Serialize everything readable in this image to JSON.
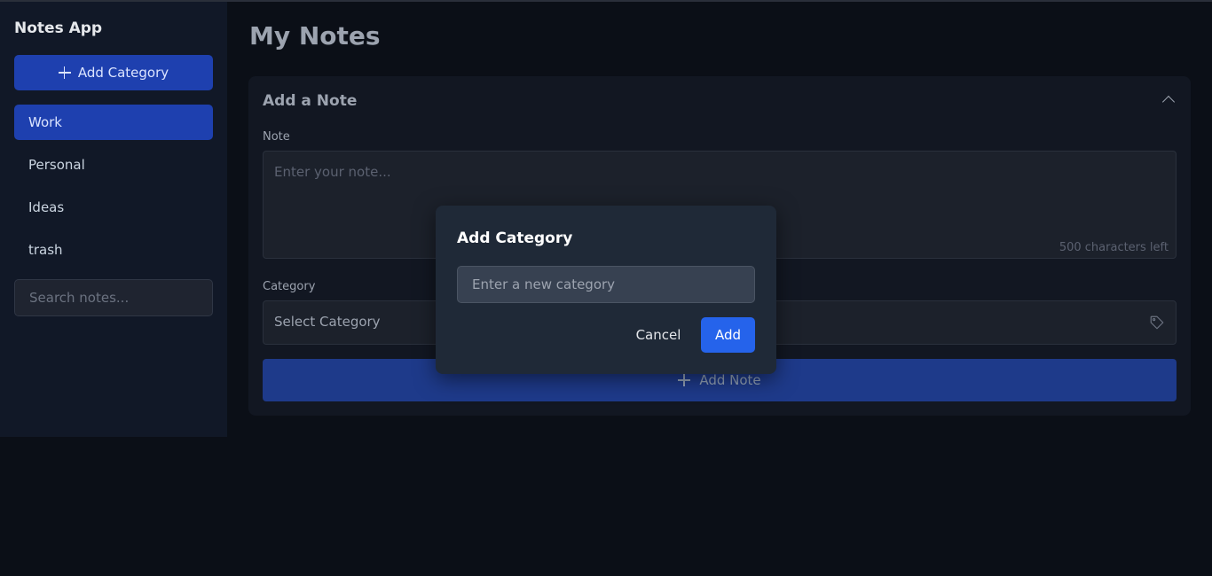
{
  "sidebar": {
    "app_title": "Notes App",
    "add_category_label": "Add Category",
    "categories": [
      {
        "label": "Work",
        "active": true
      },
      {
        "label": "Personal",
        "active": false
      },
      {
        "label": "Ideas",
        "active": false
      },
      {
        "label": "trash",
        "active": false
      }
    ],
    "search_placeholder": "Search notes..."
  },
  "main": {
    "title": "My Notes",
    "card": {
      "header": "Add a Note",
      "note_label": "Note",
      "note_placeholder": "Enter your note...",
      "chars_left": "500 characters left",
      "category_label": "Category",
      "category_select": "Select Category",
      "add_note_label": "Add Note"
    }
  },
  "modal": {
    "title": "Add Category",
    "input_placeholder": "Enter a new category",
    "cancel_label": "Cancel",
    "add_label": "Add"
  },
  "icons": {
    "collapse": "chevron-up-icon",
    "tag": "tag-icon",
    "plus": "plus-icon"
  },
  "colors": {
    "accent": "#2563eb",
    "active_item": "#1e40af",
    "background": "#0b0f17"
  }
}
